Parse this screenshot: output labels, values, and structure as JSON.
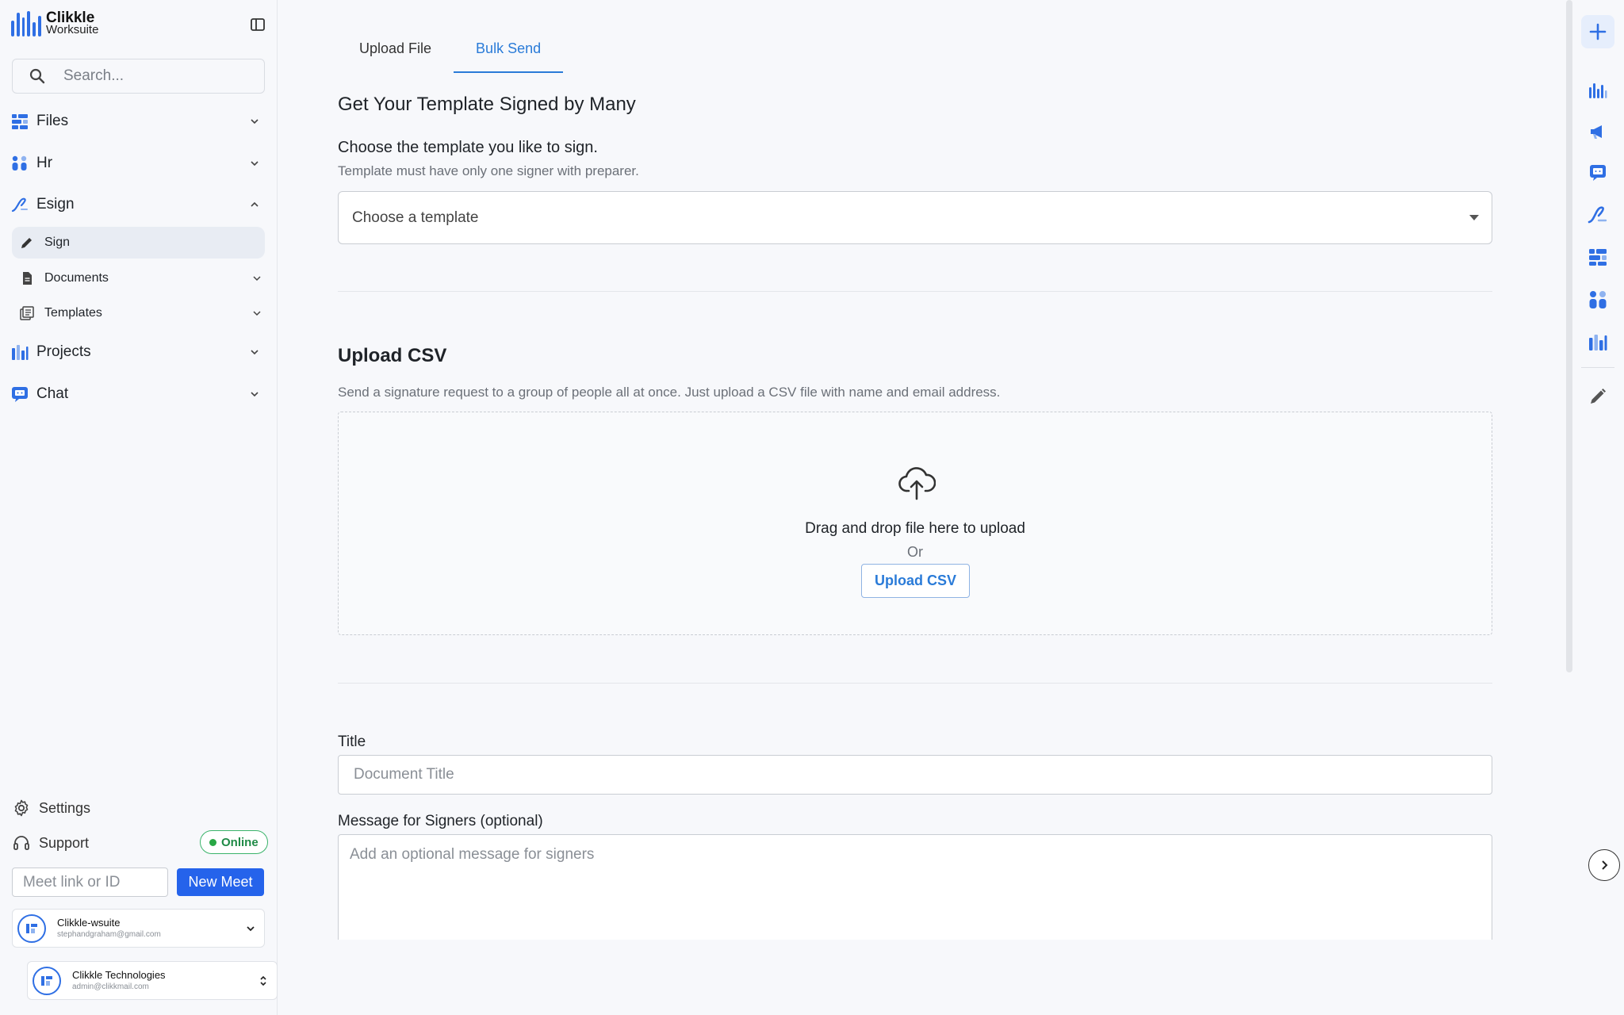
{
  "brand": {
    "line1": "Clikkle",
    "line2": "Worksuite",
    "accent": "#2f6fe4"
  },
  "sidebar": {
    "search_placeholder": "Search...",
    "items": [
      {
        "label": "Files",
        "icon": "files-icon"
      },
      {
        "label": "Hr",
        "icon": "hr-icon"
      },
      {
        "label": "Esign",
        "icon": "esign-icon"
      },
      {
        "label": "Projects",
        "icon": "projects-icon"
      },
      {
        "label": "Chat",
        "icon": "chat-icon"
      }
    ],
    "esign_sub": [
      {
        "label": "Sign",
        "icon": "pencil-icon",
        "active": true
      },
      {
        "label": "Documents",
        "icon": "document-icon"
      },
      {
        "label": "Templates",
        "icon": "templates-icon"
      }
    ],
    "settings_label": "Settings",
    "support_label": "Support",
    "status_label": "Online",
    "meet_placeholder": "Meet link or ID",
    "new_meet_label": "New Meet",
    "accounts": [
      {
        "name": "Clikkle-wsuite",
        "email": "stephandgraham@gmail.com"
      },
      {
        "name": "Clikkle Technologies",
        "email": "admin@clikkmail.com"
      }
    ]
  },
  "main": {
    "tabs": [
      {
        "label": "Upload File",
        "active": false
      },
      {
        "label": "Bulk Send",
        "active": true
      }
    ],
    "template_section": {
      "title": "Get Your Template Signed by Many",
      "prompt": "Choose the template you like to sign.",
      "hint": "Template must have only one signer with preparer.",
      "select_placeholder": "Choose a template"
    },
    "csv_section": {
      "title": "Upload CSV",
      "description": "Send a signature request to a group of people all at once. Just upload a CSV file with name and email address.",
      "drop_text": "Drag and drop file here to upload",
      "or_text": "Or",
      "button_label": "Upload CSV"
    },
    "form": {
      "title_label": "Title",
      "title_placeholder": "Document Title",
      "message_label": "Message for Signers (optional)",
      "message_placeholder": "Add an optional message for signers"
    }
  },
  "rail": {
    "icons": [
      "plus-icon",
      "clikkle-apps-icon",
      "campaigns-icon",
      "chat-app-icon",
      "esign-app-icon",
      "files-app-icon",
      "hr-app-icon",
      "projects-app-icon",
      "edit-icon"
    ]
  },
  "colors": {
    "primary": "#2563eb",
    "tab_active": "#2a7bd8",
    "online": "#28a745"
  }
}
